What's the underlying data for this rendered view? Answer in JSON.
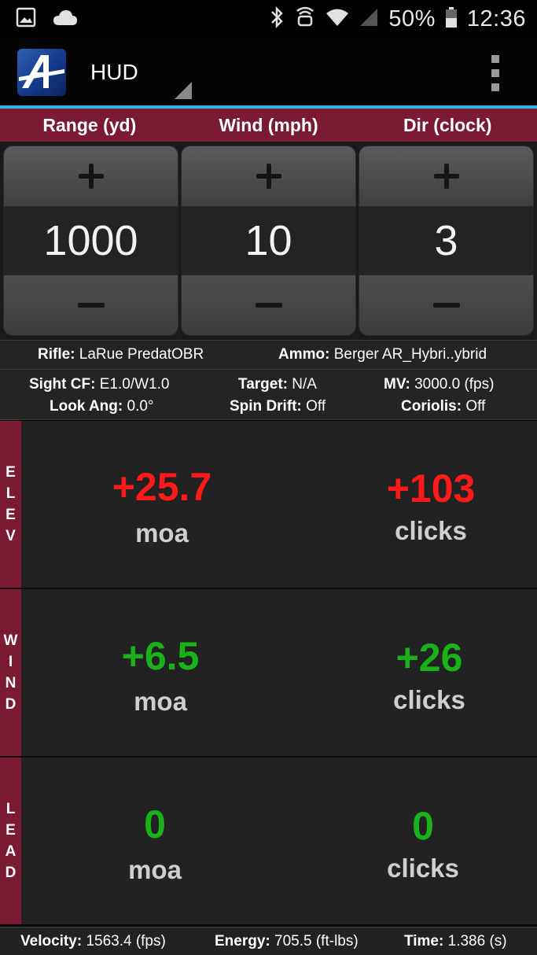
{
  "status": {
    "battery": "50%",
    "time": "12:36"
  },
  "app": {
    "title": "HUD"
  },
  "headers": {
    "range": "Range (yd)",
    "wind": "Wind (mph)",
    "dir": "Dir (clock)"
  },
  "steppers": {
    "range_value": "1000",
    "wind_value": "10",
    "dir_value": "3"
  },
  "info": {
    "rifle_label": "Rifle:",
    "rifle_value": "LaRue PredatOBR",
    "ammo_label": "Ammo:",
    "ammo_value": "Berger AR_Hybri..ybrid",
    "sightcf_label": "Sight CF:",
    "sightcf_value": "E1.0/W1.0",
    "target_label": "Target:",
    "target_value": "N/A",
    "mv_label": "MV:",
    "mv_value": "3000.0 (fps)",
    "lookang_label": "Look Ang:",
    "lookang_value": "0.0°",
    "spindrift_label": "Spin Drift:",
    "spindrift_value": "Off",
    "coriolis_label": "Coriolis:",
    "coriolis_value": "Off"
  },
  "elev": {
    "side": [
      "E",
      "L",
      "E",
      "V"
    ],
    "moa_value": "+25.7",
    "moa_unit": "moa",
    "clicks_value": "+103",
    "clicks_unit": "clicks"
  },
  "wind": {
    "side": [
      "W",
      "I",
      "N",
      "D"
    ],
    "moa_value": "+6.5",
    "moa_unit": "moa",
    "clicks_value": "+26",
    "clicks_unit": "clicks"
  },
  "lead": {
    "side": [
      "L",
      "E",
      "A",
      "D"
    ],
    "moa_value": "0",
    "moa_unit": "moa",
    "clicks_value": "0",
    "clicks_unit": "clicks"
  },
  "footer": {
    "velocity_label": "Velocity:",
    "velocity_value": "1563.4 (fps)",
    "energy_label": "Energy:",
    "energy_value": "705.5 (ft-lbs)",
    "time_label": "Time:",
    "time_value": "1.386 (s)"
  },
  "colors": {
    "accent_maroon": "#7a1a33",
    "accent_blue": "#33b5e5",
    "positive_red": "#ff1a1a",
    "positive_green": "#19b21a"
  },
  "icons": [
    "gallery-icon",
    "cloud-icon",
    "bluetooth-icon",
    "nfc-icon",
    "wifi-icon",
    "signal-icon",
    "battery-icon",
    "app-logo-icon",
    "overflow-menu-icon",
    "plus-icon",
    "minus-icon"
  ]
}
